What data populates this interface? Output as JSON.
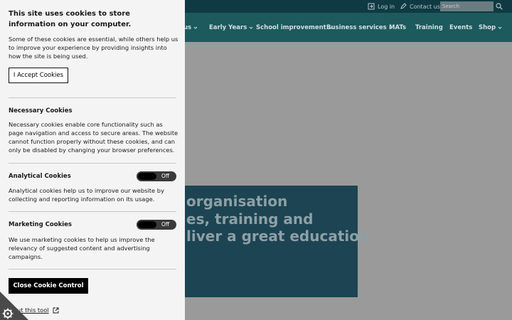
{
  "topbar": {
    "login_label": "Log in",
    "contact_label": "Contact us",
    "search_placeholder": "Search"
  },
  "nav": {
    "items": [
      {
        "label": "us",
        "chevron": true
      },
      {
        "label": "Early Years",
        "chevron": true
      },
      {
        "label": "School improvement",
        "chevron": true
      },
      {
        "label": "Business services",
        "chevron": true
      },
      {
        "label": "MATs",
        "chevron": false
      },
      {
        "label": "Training",
        "chevron": false
      },
      {
        "label": "Events",
        "chevron": false
      },
      {
        "label": "Shop",
        "chevron": true
      }
    ]
  },
  "hero": {
    "line1": "organisation",
    "line2": "es, training and",
    "line3": "liver a great education"
  },
  "cookie": {
    "title": "This site uses cookies to store information on your computer.",
    "intro": "Some of these cookies are essential, while others help us to improve your experience by providing insights into how the site is being used.",
    "accept_label": "I Accept Cookies",
    "necessary": {
      "title": "Necessary Cookies",
      "text": "Necessary cookies enable core functionality such as page navigation and access to secure areas. The website cannot function properly without these cookies, and can only be disabled by changing your browser preferences."
    },
    "analytical": {
      "title": "Analytical Cookies",
      "text": "Analytical cookies help us to improve our website by collecting and reporting information on its usage.",
      "toggle_label": "Off"
    },
    "marketing": {
      "title": "Marketing Cookies",
      "text": "We use marketing cookies to help us improve the relevancy of suggested content and advertising campaigns.",
      "toggle_label": "Off"
    },
    "close_label": "Close Cookie Control",
    "about_label": "ut this tool"
  },
  "colors": {
    "topbar_bg": "#0f3a43",
    "nav_bg": "#1c5a5e",
    "hero_box": "#1d4452",
    "panel_bg": "#f4f4f4"
  }
}
